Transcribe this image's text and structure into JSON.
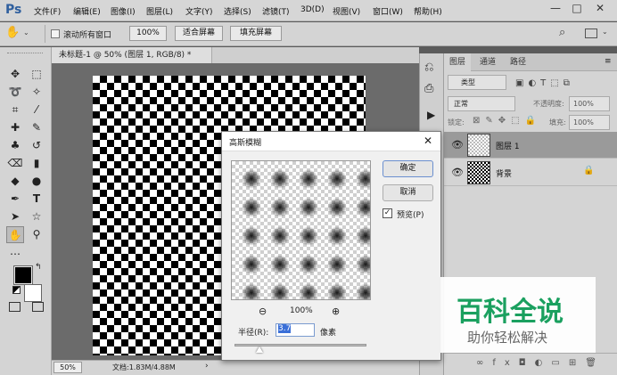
{
  "app": {
    "logo": "Ps"
  },
  "menu": [
    "文件(F)",
    "编辑(E)",
    "图像(I)",
    "图层(L)",
    "文字(Y)",
    "选择(S)",
    "滤镜(T)",
    "3D(D)",
    "视图(V)",
    "窗口(W)",
    "帮助(H)"
  ],
  "window_controls": {
    "minimize": "—",
    "maximize": "□",
    "close": "✕"
  },
  "options": {
    "scroll_all": "滚动所有窗口",
    "zoom": "100%",
    "fit_screen": "适合屏幕",
    "fill_screen": "填充屏幕"
  },
  "document": {
    "tab": "未标题-1 @ 50% (图层 1, RGB/8) *",
    "zoom": "50%",
    "docinfo": "文档:1.83M/4.88M"
  },
  "panel": {
    "tabs": [
      "图层",
      "通道",
      "路径"
    ],
    "kind": "类型",
    "blend": "正常",
    "opacity_label": "不透明度:",
    "opacity": "100%",
    "lock_label": "锁定:",
    "fill_label": "填充:",
    "fill": "100%",
    "layers": [
      {
        "name": "图层 1"
      },
      {
        "name": "背景"
      }
    ]
  },
  "dialog": {
    "title": "高斯模糊",
    "close": "✕",
    "ok": "确定",
    "cancel": "取消",
    "preview_label": "预览(P)",
    "preview_checked": true,
    "zoom_value": "100%",
    "radius_label": "半径(R):",
    "radius_value": "3.7",
    "radius_unit": "像素"
  },
  "watermark": {
    "title": "百科全说",
    "subtitle": "助你轻松解决"
  }
}
